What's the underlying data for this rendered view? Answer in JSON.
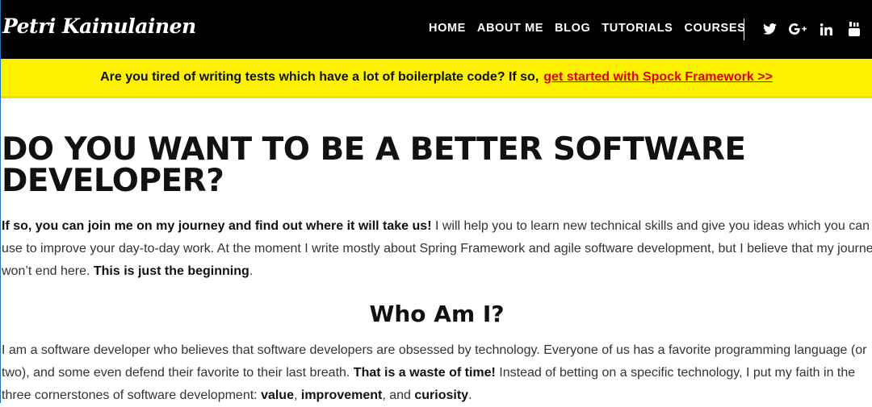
{
  "header": {
    "logo": "Petri Kainulainen",
    "nav": [
      "HOME",
      "ABOUT ME",
      "BLOG",
      "TUTORIALS",
      "COURSES"
    ],
    "social_icons": [
      "twitter-icon",
      "google-plus-icon",
      "linkedin-icon",
      "youtube-icon"
    ]
  },
  "banner": {
    "text": "Are you tired of writing tests which have a lot of boilerplate code? If so,",
    "link": "get started with Spock Framework >>",
    "link_color": "#e00000",
    "background": "#fff200"
  },
  "main": {
    "title": "DO YOU WANT TO BE A BETTER SOFTWARE DEVELOPER?",
    "intro": {
      "line1_bold": "If so, you can join me on my journey and find out where it will take us!",
      "line1_rest": " I will help you to learn new technical skills and give you ideas which you can",
      "line2": "use to improve your day-to-day work. At the moment I write mostly about Spring Framework and agile software development, but I believe that my journey",
      "line3_start": "won’t end here. ",
      "line3_bold": "This is just the beginning",
      "line3_end": "."
    },
    "who_heading": "Who Am I?",
    "who": {
      "line1": "I am a software developer who believes that software developers are obsessed by technology. Everyone of us has a favorite programming language (or",
      "line2_start": "two), and some even defend their favorite to their last breath. ",
      "line2_bold": "That is a waste of time!",
      "line2_end": " Instead of betting on a specific technology, I put my faith in the",
      "line3_start": "three cornerstones of software development: ",
      "value": "value",
      "sep1": ", ",
      "improvement": "improvement",
      "sep2": ", and ",
      "curiosity": "curiosity",
      "end": "."
    }
  }
}
